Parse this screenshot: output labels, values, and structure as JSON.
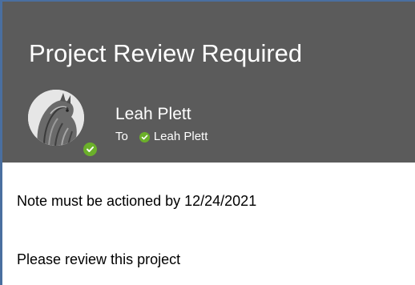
{
  "message": {
    "subject": "Project Review Required",
    "sender": {
      "name": "Leah Plett",
      "avatar_icon": "sender-avatar",
      "presence": "available",
      "presence_color": "#6bb02a"
    },
    "to_label": "To",
    "recipient": {
      "name": "Leah Plett",
      "presence": "available"
    },
    "body": {
      "line1": "Note must be actioned by 12/24/2021",
      "line2": "Please review this project"
    }
  },
  "colors": {
    "header_bg": "#5b5b5b",
    "border_accent": "#4a6fa0",
    "presence_green": "#6bb02a"
  }
}
